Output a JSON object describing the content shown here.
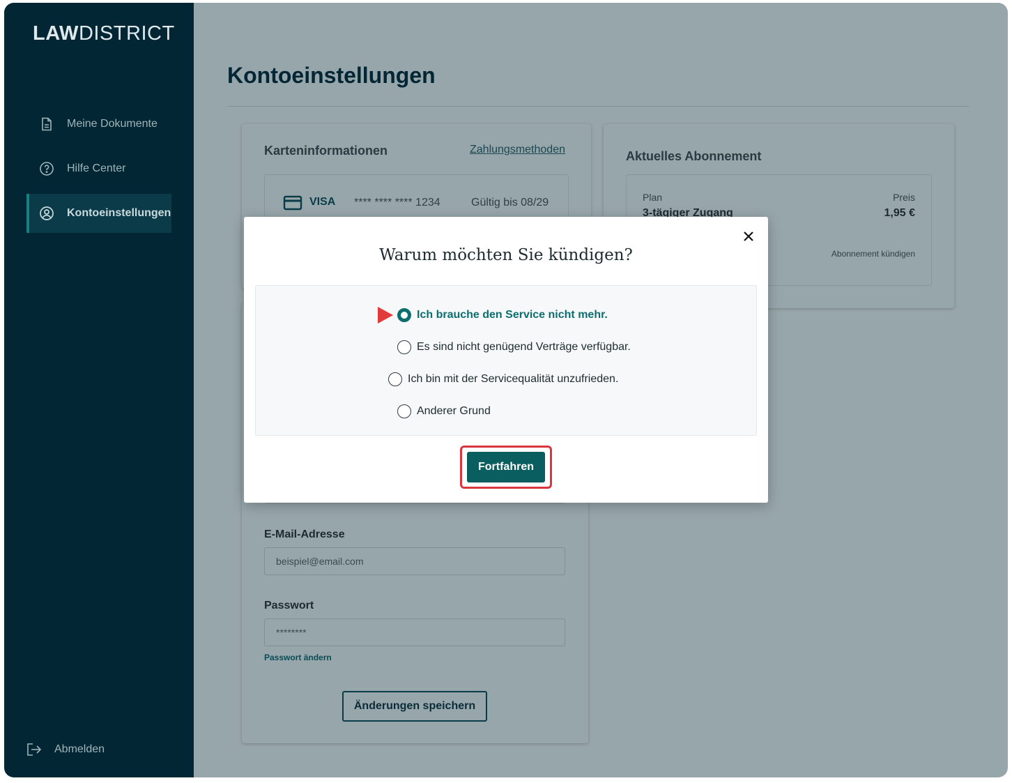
{
  "brand": {
    "logo_bold": "LAW",
    "logo_light": "DISTRICT"
  },
  "sidebar": {
    "items": [
      {
        "label": "Meine Dokumente",
        "icon": "document-icon"
      },
      {
        "label": "Hilfe Center",
        "icon": "help-circle-icon"
      },
      {
        "label": "Kontoeinstellungen",
        "icon": "user-circle-icon",
        "active": true
      }
    ],
    "logout_label": "Abmelden"
  },
  "page": {
    "title": "Kontoeinstellungen"
  },
  "card_info": {
    "heading": "Karteninformationen",
    "link": "Zahlungsmethoden",
    "brand": "VISA",
    "masked_number": "**** **** **** 1234",
    "valid": "Gültig bis 08/29"
  },
  "subscription": {
    "heading": "Aktuelles Abonnement",
    "plan_label": "Plan",
    "plan_value": "3-tägiger Zugang",
    "price_label": "Preis",
    "price_value": "1,95 €",
    "cancel_link": "Abonnement kündigen"
  },
  "account": {
    "email_label": "E-Mail-Adresse",
    "email_placeholder": "beispiel@email.com",
    "password_label": "Passwort",
    "password_value": "********",
    "change_password": "Passwort ändern",
    "save_label": "Änderungen speichern"
  },
  "modal": {
    "title": "Warum möchten Sie kündigen?",
    "options": [
      {
        "label": "Ich brauche den Service nicht mehr.",
        "selected": true
      },
      {
        "label": "Es sind nicht genügend Verträge verfügbar.",
        "selected": false
      },
      {
        "label": "Ich bin mit der Servicequalität unzufrieden.",
        "selected": false
      },
      {
        "label": "Anderer Grund",
        "selected": false
      }
    ],
    "continue_label": "Fortfahren"
  },
  "colors": {
    "sidebar_bg": "#022634",
    "accent": "#0d6e6f",
    "highlight": "#d9363e",
    "overlay": "#97a6ab"
  }
}
